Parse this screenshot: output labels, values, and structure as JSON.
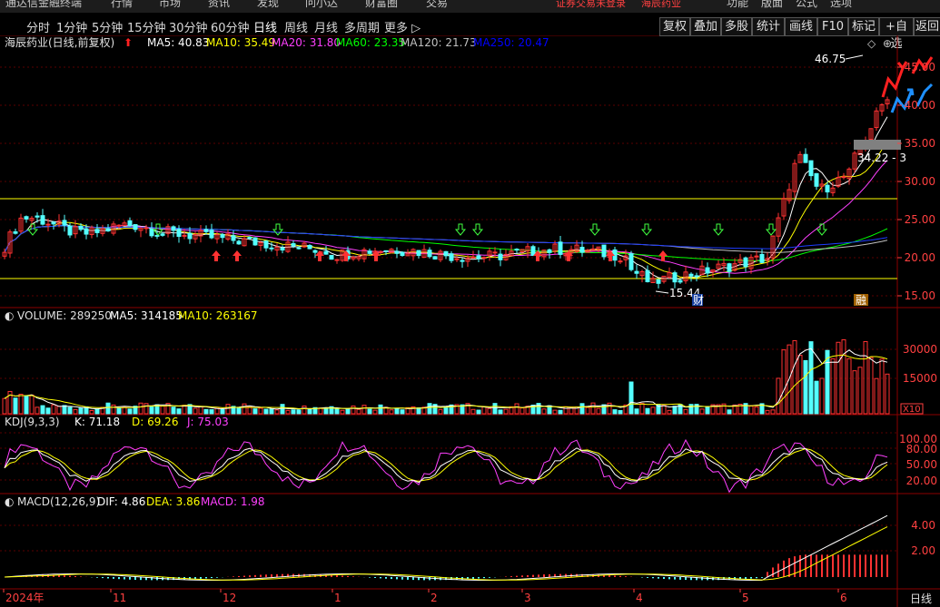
{
  "menu": {
    "app_title": "通达信金融终端",
    "items": [
      "行情",
      "市场",
      "资讯",
      "发现",
      "问小达",
      "财富圈",
      "交易"
    ],
    "login_status": "证券交易未登录",
    "stock_name": "海辰药业",
    "right_items": [
      "功能",
      "版面",
      "公式",
      "选项"
    ]
  },
  "tabs": [
    "分时",
    "1分钟",
    "5分钟",
    "15分钟",
    "30分钟",
    "60分钟",
    "日线",
    "周线",
    "月线",
    "多周期",
    "更多 ▷"
  ],
  "active_tab": "日线",
  "toolbar": [
    "复权",
    "叠加",
    "多股",
    "统计",
    "画线",
    "F10",
    "标记",
    "+自选",
    "返回"
  ],
  "price_panel": {
    "title": "海辰药业(日线,前复权)",
    "ma": [
      {
        "label": "MA5: 40.83",
        "color": "#ffffff"
      },
      {
        "label": "MA10: 35.49",
        "color": "#ffff00"
      },
      {
        "label": "MA20: 31.80",
        "color": "#ff40ff"
      },
      {
        "label": "MA60: 23.35",
        "color": "#00ff00"
      },
      {
        "label": "MA120: 21.73",
        "color": "#c0c0c0"
      },
      {
        "label": "MA250: 20.47",
        "color": "#0000ff"
      }
    ],
    "y_ticks": [
      "45.00",
      "40.00",
      "35.00",
      "30.00",
      "25.00",
      "20.00",
      "15.00"
    ],
    "high_label": "46.75",
    "low_label": "15.44",
    "current_label": "34.22 - 3",
    "cai_label": "财",
    "rong_label": "融"
  },
  "volume_panel": {
    "title": "VOLUME: 289250",
    "ma5": "MA5: 314185",
    "ma10": "MA10: 263167",
    "y_ticks": [
      "30000",
      "15000"
    ],
    "unit": "X10"
  },
  "kdj_panel": {
    "title": "KDJ(9,3,3)",
    "k": "K: 71.18",
    "d": "D: 69.26",
    "j": "J: 75.03",
    "y_ticks": [
      "100.00",
      "80.00",
      "50.00",
      "20.00"
    ]
  },
  "macd_panel": {
    "title": "MACD(12,26,9)",
    "dif": "DIF: 4.86",
    "dea": "DEA: 3.86",
    "macd": "MACD: 1.98",
    "y_ticks": [
      "4.00",
      "2.00"
    ]
  },
  "x_axis": {
    "labels": [
      "2024年",
      "11",
      "12",
      "1",
      "2",
      "3",
      "4",
      "5",
      "6"
    ],
    "period": "日线"
  },
  "colors": {
    "up": "#ff3232",
    "down": "#54ffff",
    "grid": "#8b0000",
    "axis_text": "#ff4040",
    "hline": "#ffff00"
  }
}
